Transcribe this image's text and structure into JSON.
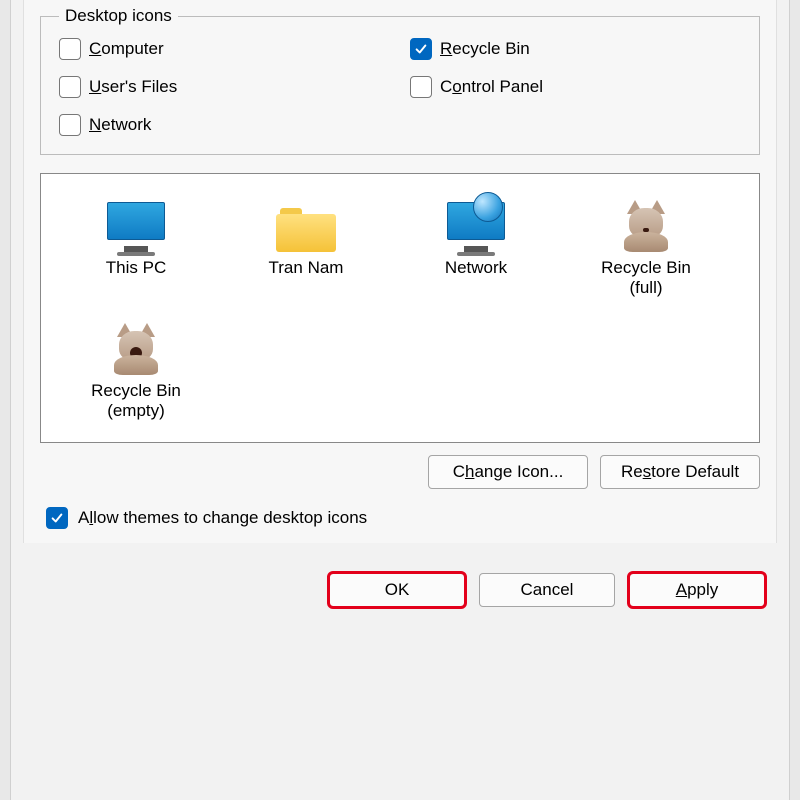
{
  "group": {
    "legend": "Desktop icons",
    "checks": {
      "computer": {
        "label_pre": "",
        "accel": "C",
        "label_post": "omputer",
        "checked": false
      },
      "recyclebin": {
        "label_pre": "",
        "accel": "R",
        "label_post": "ecycle Bin",
        "checked": true
      },
      "usersfiles": {
        "label_pre": "",
        "accel": "U",
        "label_post": "ser's Files",
        "checked": false
      },
      "controlpanel": {
        "label_pre": "C",
        "accel": "o",
        "label_post": "ntrol Panel",
        "checked": false
      },
      "network": {
        "label_pre": "",
        "accel": "N",
        "label_post": "etwork",
        "checked": false
      }
    }
  },
  "icons": {
    "thispc": {
      "label": "This PC"
    },
    "trannam": {
      "label": "Tran Nam"
    },
    "network": {
      "label": "Network"
    },
    "rbfull": {
      "label": "Recycle Bin\n(full)"
    },
    "rbempty": {
      "label": "Recycle Bin\n(empty)"
    }
  },
  "buttons": {
    "changeicon": {
      "pre": "C",
      "accel": "h",
      "post": "ange Icon..."
    },
    "restoredefault": {
      "pre": "Re",
      "accel": "s",
      "post": "tore Default"
    }
  },
  "allowthemes": {
    "pre": "A",
    "accel": "l",
    "post": "low themes to change desktop icons",
    "checked": true
  },
  "dialog": {
    "ok": "OK",
    "cancel": "Cancel",
    "apply": {
      "accel": "A",
      "post": "pply"
    }
  }
}
